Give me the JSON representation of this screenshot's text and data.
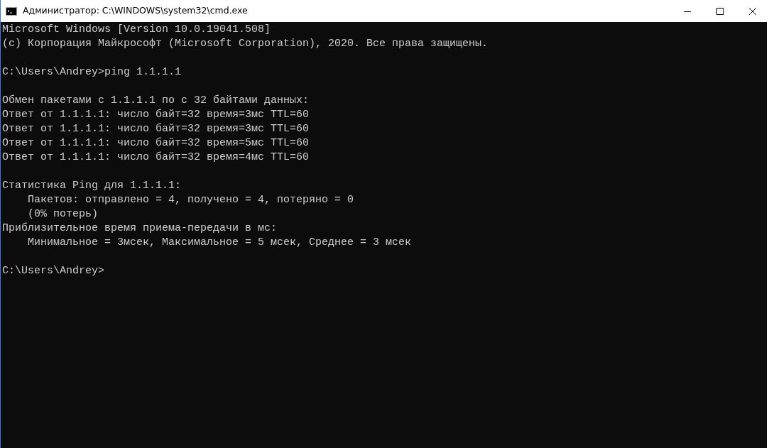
{
  "window": {
    "title": "Администратор: C:\\WINDOWS\\system32\\cmd.exe"
  },
  "console": {
    "blocks": [
      [
        "Microsoft Windows [Version 10.0.19041.508]",
        "(c) Корпорация Майкрософт (Microsoft Corporation), 2020. Все права защищены."
      ],
      [
        "C:\\Users\\Andrey>ping 1.1.1.1"
      ],
      [
        "Обмен пакетами с 1.1.1.1 по с 32 байтами данных:",
        "Ответ от 1.1.1.1: число байт=32 время=3мс TTL=60",
        "Ответ от 1.1.1.1: число байт=32 время=3мс TTL=60",
        "Ответ от 1.1.1.1: число байт=32 время=5мс TTL=60",
        "Ответ от 1.1.1.1: число байт=32 время=4мс TTL=60"
      ],
      [
        "Статистика Ping для 1.1.1.1:",
        "    Пакетов: отправлено = 4, получено = 4, потеряно = 0",
        "    (0% потерь)",
        "Приблизительное время приема-передачи в мс:",
        "    Минимальное = 3мсек, Максимальное = 5 мсек, Среднее = 3 мсек"
      ],
      [
        "C:\\Users\\Andrey>"
      ]
    ]
  }
}
